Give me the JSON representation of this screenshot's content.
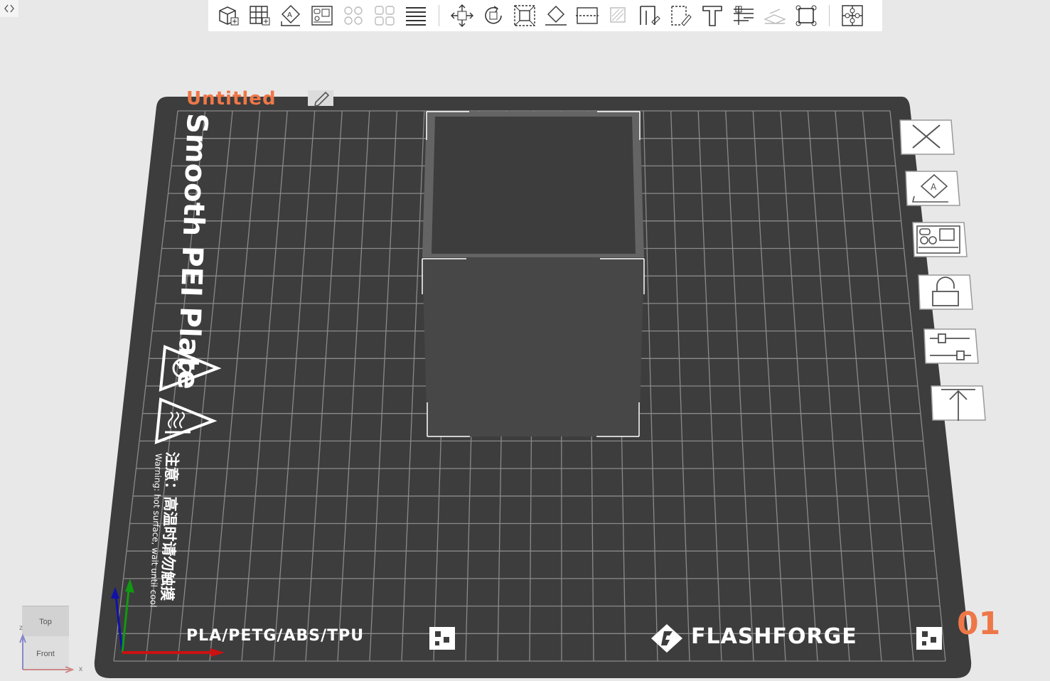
{
  "toolbar": {
    "items": [
      {
        "name": "add-object-icon"
      },
      {
        "name": "add-plate-icon"
      },
      {
        "name": "auto-orient-icon"
      },
      {
        "name": "arrange-icon"
      },
      {
        "name": "split-objects-icon"
      },
      {
        "name": "split-parts-icon"
      },
      {
        "name": "layers-icon"
      },
      {
        "name": "move-icon"
      },
      {
        "name": "rotate-icon"
      },
      {
        "name": "scale-icon"
      },
      {
        "name": "place-on-face-icon"
      },
      {
        "name": "cut-icon"
      },
      {
        "name": "support-paint-icon"
      },
      {
        "name": "seam-paint-icon"
      },
      {
        "name": "color-paint-icon"
      },
      {
        "name": "text-icon"
      },
      {
        "name": "measure-icon"
      },
      {
        "name": "assembly-icon"
      },
      {
        "name": "brim-ears-icon"
      },
      {
        "name": "variable-layer-icon"
      }
    ]
  },
  "plate": {
    "name": "Untitled",
    "type_label": "Smooth PEI Plate",
    "warning_cn": "注意：高温时请勿触摸",
    "warning_en": "Warning: hot surface, wait until cool",
    "materials": "PLA/PETG/ABS/TPU",
    "brand": "FLASHFORGE",
    "number": "01"
  },
  "plate_side_buttons": [
    {
      "name": "delete-plate-icon"
    },
    {
      "name": "auto-orient-plate-icon"
    },
    {
      "name": "arrange-plate-icon"
    },
    {
      "name": "lock-plate-icon"
    },
    {
      "name": "plate-settings-icon"
    },
    {
      "name": "move-plate-to-top-icon"
    }
  ],
  "view_cube": {
    "top": "Top",
    "front": "Front"
  },
  "axes": {
    "x": "x",
    "z": "z"
  },
  "colors": {
    "background": "#e8e8e8",
    "plate": "#3d3d3d",
    "plate_name": "#ee7748",
    "object": "#474747",
    "axis_x": "#cc1111",
    "axis_y": "#119911",
    "axis_z": "#1111aa"
  }
}
